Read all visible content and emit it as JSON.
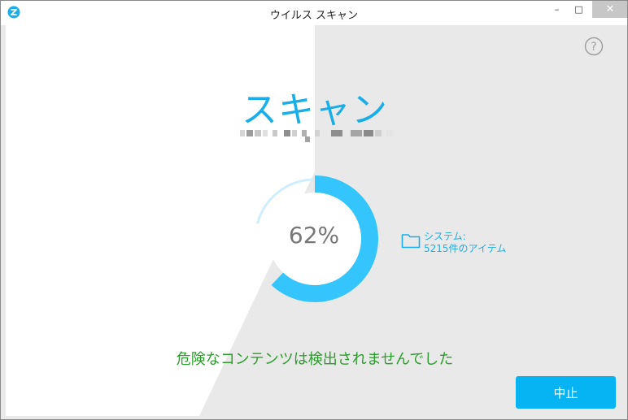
{
  "window": {
    "title": "ウイルス スキャン",
    "icon": "app-logo-icon",
    "controls": {
      "minimize": "–",
      "maximize": "□",
      "close": "✕"
    }
  },
  "help": {
    "icon": "question-icon",
    "glyph": "?"
  },
  "scan": {
    "heading": "スキャン",
    "progress_percent": 62,
    "progress_label": "62%",
    "location_label": "システム:",
    "item_count_label": "5215件のアイテム",
    "folder_icon": "folder-icon",
    "status_message": "危険なコンテンツは検出されませんでした"
  },
  "actions": {
    "stop_label": "中止"
  },
  "colors": {
    "accent": "#1aaee8",
    "ring": "#33c5fb",
    "status_ok": "#2e9c2e",
    "button": "#06b4f3"
  }
}
